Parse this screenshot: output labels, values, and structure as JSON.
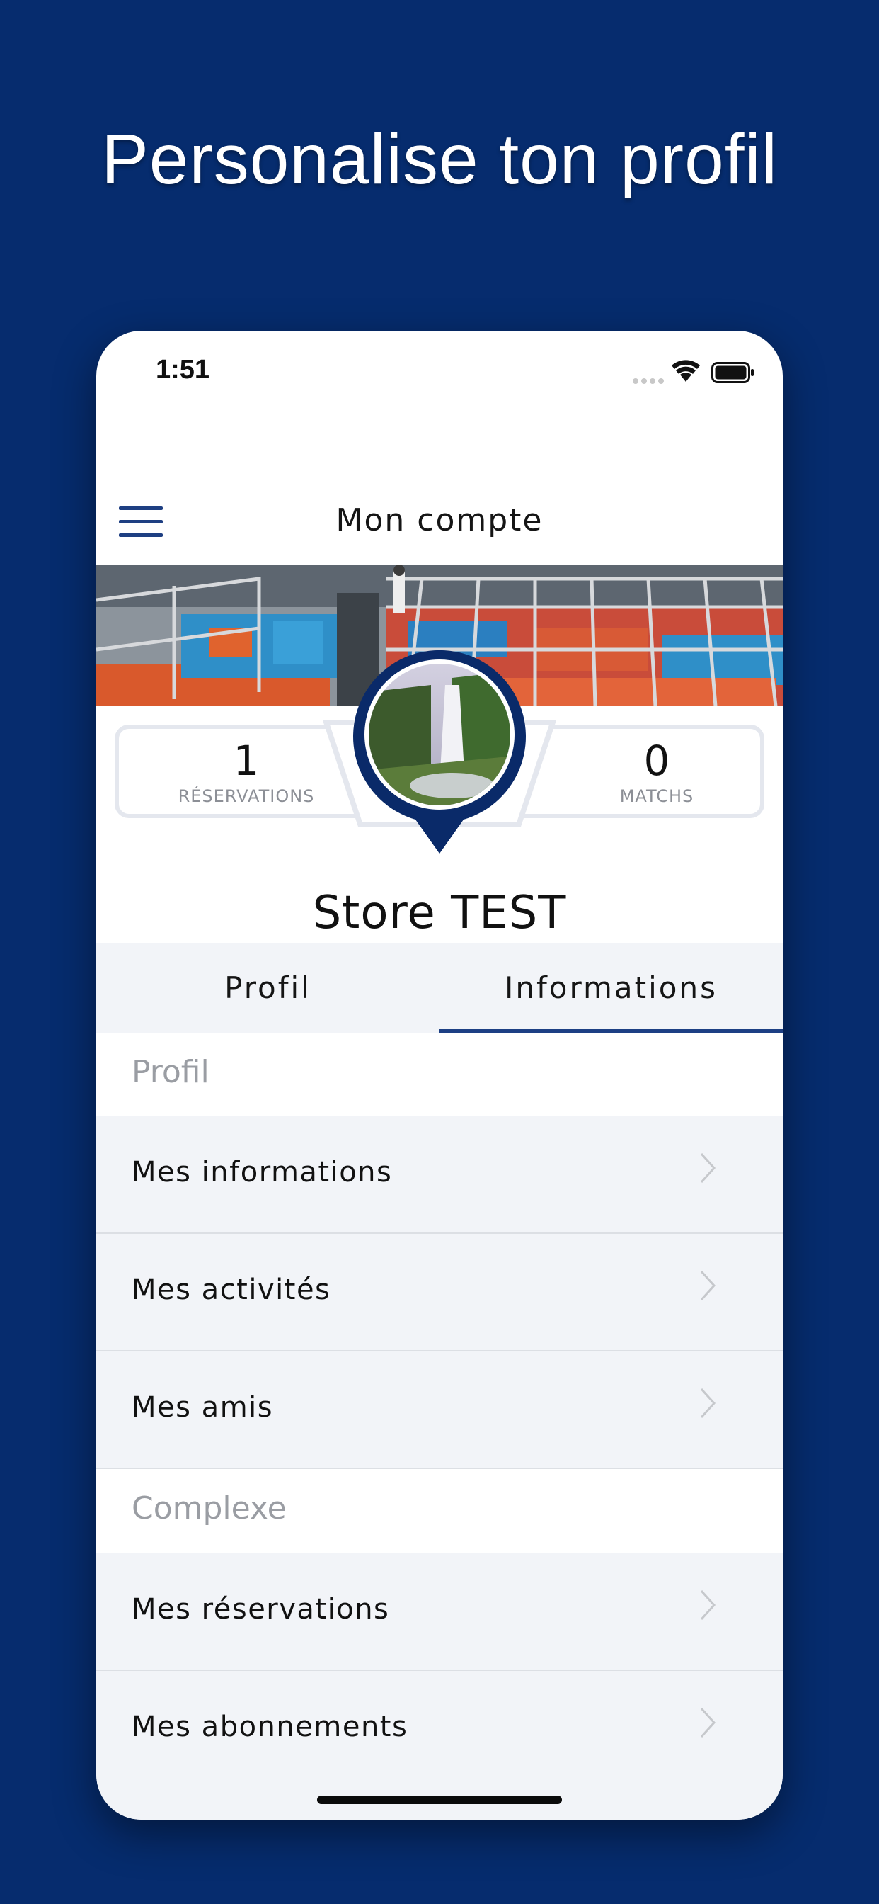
{
  "promo": {
    "title": "Personalise ton profil"
  },
  "status_bar": {
    "time": "1:51"
  },
  "nav": {
    "title": "Mon compte"
  },
  "stats": {
    "reservations": {
      "value": "1",
      "label": "RÉSERVATIONS"
    },
    "matchs": {
      "value": "0",
      "label": "MATCHS"
    }
  },
  "profile": {
    "name": "Store  TEST"
  },
  "tabs": [
    {
      "label": "Profil",
      "active": false
    },
    {
      "label": "Informations",
      "active": true
    }
  ],
  "sections": [
    {
      "header": "Profil",
      "items": [
        {
          "label": "Mes informations"
        },
        {
          "label": "Mes activités"
        },
        {
          "label": "Mes amis"
        }
      ]
    },
    {
      "header": "Complexe",
      "items": [
        {
          "label": "Mes réservations"
        },
        {
          "label": "Mes abonnements"
        }
      ]
    }
  ],
  "colors": {
    "background": "#062c6e",
    "accent": "#1d3f84",
    "row_background": "#f2f4f8",
    "section_header_text": "#9a9da3"
  }
}
